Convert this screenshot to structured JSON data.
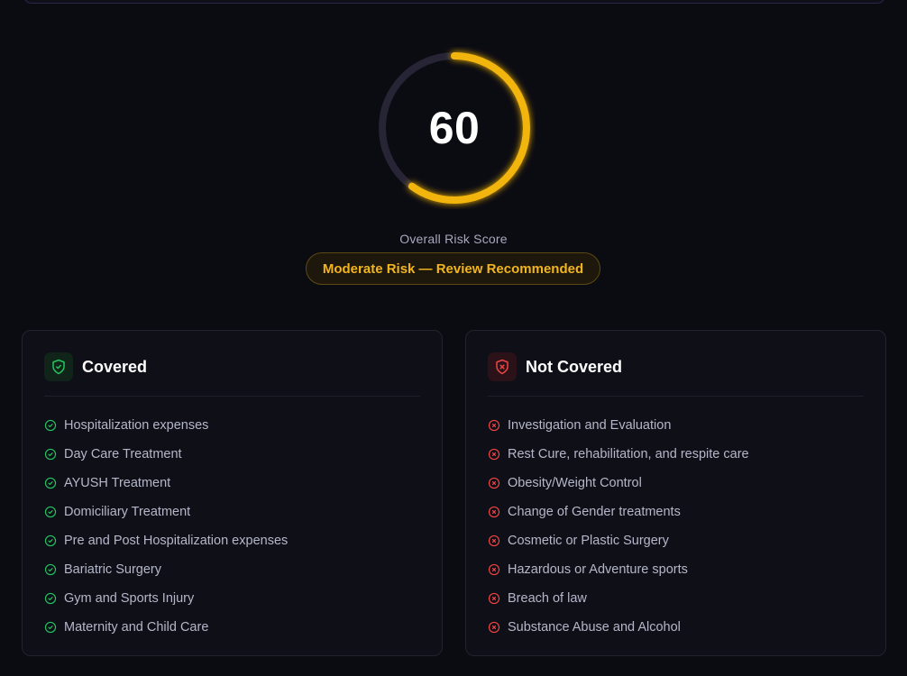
{
  "risk": {
    "score": "60",
    "score_fraction": 0.6,
    "label": "Overall Risk Score",
    "badge": "Moderate Risk — Review Recommended"
  },
  "colors": {
    "background": "#0b0b12",
    "gauge_fill": "#f2b511",
    "gauge_track": "#262435",
    "covered_accent": "#22c55e",
    "not_covered_accent": "#ef4444"
  },
  "covered": {
    "title": "Covered",
    "icon": "shield-check-icon",
    "items": [
      "Hospitalization expenses",
      "Day Care Treatment",
      "AYUSH Treatment",
      "Domiciliary Treatment",
      "Pre and Post Hospitalization expenses",
      "Bariatric Surgery",
      "Gym and Sports Injury",
      "Maternity and Child Care"
    ]
  },
  "not_covered": {
    "title": "Not Covered",
    "icon": "shield-x-icon",
    "items": [
      "Investigation and Evaluation",
      "Rest Cure, rehabilitation, and respite care",
      "Obesity/Weight Control",
      "Change of Gender treatments",
      "Cosmetic or Plastic Surgery",
      "Hazardous or Adventure sports",
      "Breach of law",
      "Substance Abuse and Alcohol"
    ]
  }
}
